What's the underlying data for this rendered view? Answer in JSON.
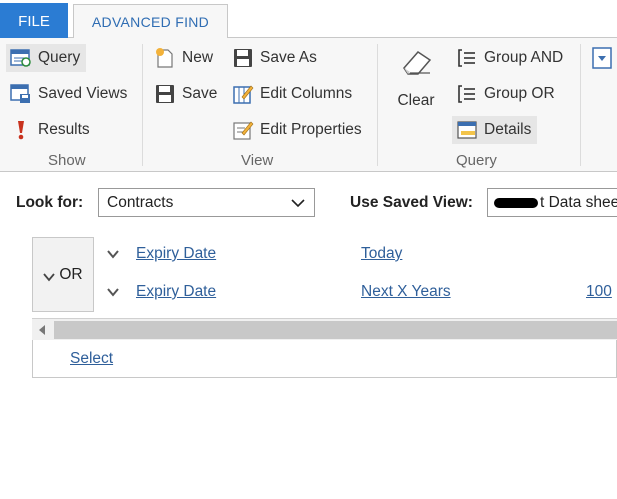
{
  "tabs": {
    "file": "FILE",
    "advanced_find": "ADVANCED FIND"
  },
  "ribbon": {
    "show": {
      "label": "Show",
      "query": "Query",
      "saved_views": "Saved Views",
      "results": "Results"
    },
    "view": {
      "label": "View",
      "new": "New",
      "save": "Save",
      "save_as": "Save As",
      "edit_columns": "Edit Columns",
      "edit_properties": "Edit Properties"
    },
    "query": {
      "label": "Query",
      "clear": "Clear",
      "group_and": "Group AND",
      "group_or": "Group OR",
      "details": "Details"
    }
  },
  "search": {
    "look_for_label": "Look for:",
    "look_for_value": "Contracts",
    "saved_view_label": "Use Saved View:",
    "saved_view_value": "t Data shee"
  },
  "query_group": {
    "operator": "OR",
    "rows": [
      {
        "field": "Expiry Date",
        "condition": "Today",
        "value": ""
      },
      {
        "field": "Expiry Date",
        "condition": "Next X Years",
        "value": "100"
      }
    ],
    "select_link": "Select"
  },
  "colors": {
    "file_tab_bg": "#2b7cd3",
    "link": "#2f5f9a",
    "ribbon_bg": "#f7f7f7"
  }
}
